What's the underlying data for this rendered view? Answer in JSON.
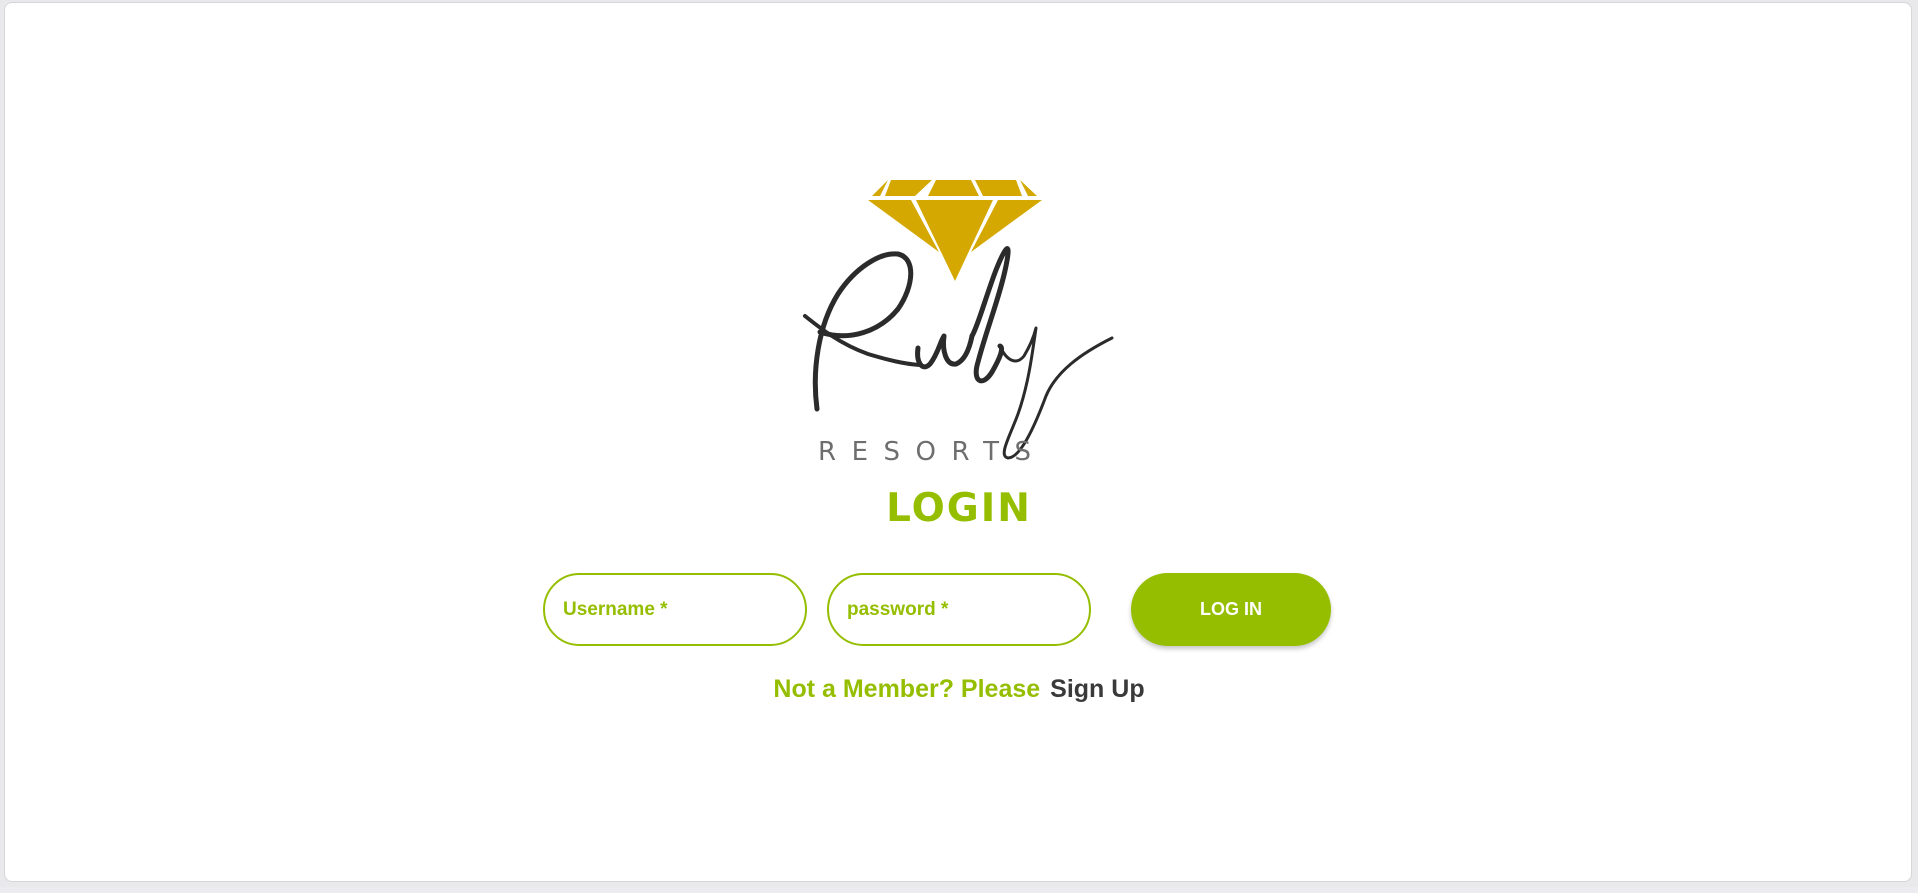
{
  "brand": {
    "script_name": "Ruby",
    "subtitle": "RESORTS",
    "gem_color": "#d4a800",
    "ink_color": "#2b2b2b"
  },
  "login": {
    "title": "LOGIN",
    "username_placeholder": "Username *",
    "password_placeholder": "password *",
    "submit_label": "LOG IN"
  },
  "signup": {
    "prompt": "Not a Member? Please",
    "link_label": "Sign Up"
  },
  "colors": {
    "accent": "#95be00",
    "link": "#3a3a3a",
    "background": "#ffffff"
  }
}
